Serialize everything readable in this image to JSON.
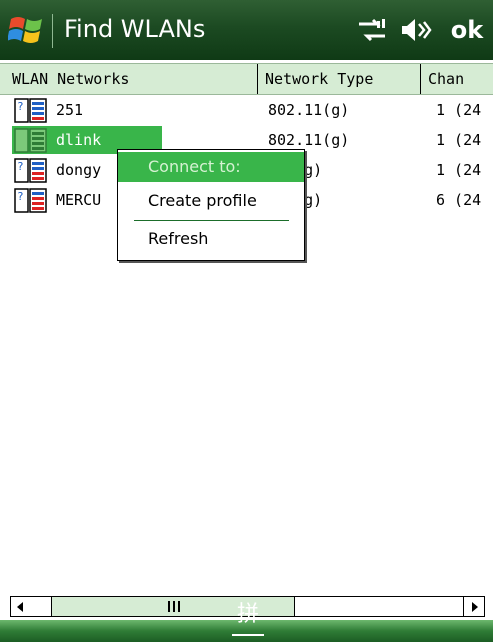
{
  "titlebar": {
    "title": "Find WLANs",
    "ok_label": "ok",
    "start_icon": "windows-flag-icon",
    "connectivity_icon": "connectivity-icon",
    "volume_icon": "volume-icon"
  },
  "table": {
    "columns": [
      "WLAN Networks",
      "Network Type",
      "Chan"
    ],
    "rows": [
      {
        "name": "251",
        "type": "802.11(g)",
        "chan": "1 (24"
      },
      {
        "name": "dlink",
        "type": "802.11(g)",
        "chan": "1 (24",
        "selected": true
      },
      {
        "name": "dongy",
        "type": ".11(g)",
        "chan": "1 (24"
      },
      {
        "name": "MERCU",
        "type": ".11(g)",
        "chan": "6 (24"
      }
    ]
  },
  "context_menu": {
    "items": [
      {
        "label": "Connect to:",
        "highlighted": true
      },
      {
        "label": "Create profile"
      },
      {
        "label": "Refresh"
      }
    ]
  },
  "bottombar": {
    "ime_label": "拼"
  },
  "colors": {
    "accent": "#39b54a",
    "title_bg": "#1c4a22",
    "header_bg": "#d6ecd4"
  }
}
